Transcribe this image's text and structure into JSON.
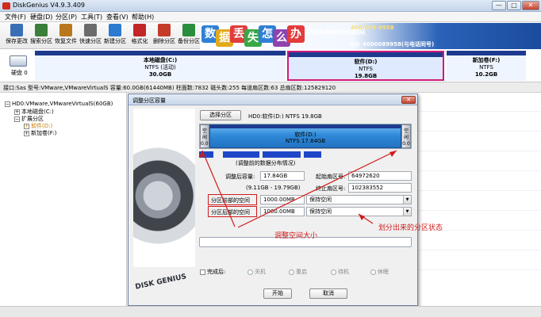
{
  "window": {
    "title": "DiskGenius V4.9.3.409",
    "controls": {
      "minimize": "—",
      "maximize": "□",
      "close": "✕"
    }
  },
  "menu": [
    "文件(F)",
    "硬盘(D)",
    "分区(P)",
    "工具(T)",
    "查看(V)",
    "帮助(H)"
  ],
  "toolbar": [
    {
      "label": "保存更改",
      "icon": "save-icon",
      "color": "#3b6fb5"
    },
    {
      "label": "搜索分区",
      "icon": "search-partition-icon",
      "color": "#3a7f3a"
    },
    {
      "label": "恢复文件",
      "icon": "restore-file-icon",
      "color": "#b9781d"
    },
    {
      "label": "快速分区",
      "icon": "quick-partition-icon",
      "color": "#6c6c6c"
    },
    {
      "label": "新建分区",
      "icon": "new-partition-icon",
      "color": "#2c7bd0"
    },
    {
      "label": "格式化",
      "icon": "format-icon",
      "color": "#c22626"
    },
    {
      "label": "删除分区",
      "icon": "delete-partition-icon",
      "color": "#c43b2a"
    },
    {
      "label": "备份分区",
      "icon": "backup-partition-icon",
      "color": "#2b8e3c"
    }
  ],
  "banner": {
    "chars": [
      "数",
      "据",
      "丢",
      "失",
      "怎",
      "么",
      "办"
    ],
    "char_colors": [
      "#2f7fd6",
      "#e2a91a",
      "#e23c3c",
      "#37a845",
      "#2f7fd6",
      "#8e44ad",
      "#e23c3c"
    ],
    "brand": "DiskGenius团队",
    "phone": "400-008-9958",
    "qq": "QQ: 4000089958(与电话同号)"
  },
  "disk_map": {
    "disk_label": "硬盘 0",
    "partitions": [
      {
        "name": "本地磁盘(C:)",
        "fs": "NTFS (活动)",
        "size": "30.0GB",
        "bg": "#eef5ff",
        "selected": false
      },
      {
        "name": "软件(D:)",
        "fs": "NTFS",
        "size": "19.8GB",
        "bg": "#dfeaff",
        "selected": true
      },
      {
        "name": "新加卷(F:)",
        "fs": "NTFS",
        "size": "10.2GB",
        "bg": "#eef5ff",
        "selected": false
      }
    ]
  },
  "info_line": "接口:Sas  型号:VMware,VMwareVirtualS  容量:60.0GB(61440MB)  柱面数:7832  磁头数:255  每道扇区数:63  总扇区数:125829120",
  "tree": [
    {
      "text": "HD0:VMware,VMwareVirtualS(60GB)",
      "indent": 0,
      "expander": "−",
      "color": "#000"
    },
    {
      "text": "本地磁盘(C:)",
      "indent": 1,
      "expander": "+",
      "color": "#000"
    },
    {
      "text": "扩展分区",
      "indent": 1,
      "expander": "−",
      "color": "#000"
    },
    {
      "text": "软件(D:)",
      "indent": 2,
      "expander": "+",
      "color": "#c97a00"
    },
    {
      "text": "新加卷(F:)",
      "indent": 2,
      "expander": "+",
      "color": "#000"
    }
  ],
  "dialog": {
    "title": "调整分区容量",
    "close": "✕",
    "art_text": "DISK GENIUS",
    "select_partition": "选择分区",
    "partition_info": "HD0:软件(D:) NTFS 19.8GB",
    "left_handle": "空闲",
    "right_handle": "空闲",
    "bar_line1": "软件(D:)",
    "bar_line2": "NTFS 17.84GB",
    "left_handle_size": "0.00",
    "right_handle_size": "0.0",
    "usage_caption": "(调整前的数据分布情况)",
    "size_after_label": "调整后容量:",
    "size_after_value": "17.84GB",
    "range_label": "(9.11GB - 19.79GB)",
    "start_sector_label": "起始扇区号:",
    "start_sector_value": "64972620",
    "end_sector_label": "终止扇区号:",
    "end_sector_value": "102383552",
    "before_space_label": "分区前部的空间",
    "before_space_value": "1000.00MB",
    "before_space_action": "保持空闲",
    "after_space_label": "分区后部的空间",
    "after_space_value": "1000.00MB",
    "after_space_action": "保持空闲",
    "done_label": "完成后:",
    "radios": [
      "关机",
      "重启",
      "待机",
      "休眠"
    ],
    "start_button": "开始",
    "cancel_button": "取消"
  },
  "annotations": {
    "resize": "调整空间大小",
    "state": "划分出来的分区状态"
  },
  "colors": {
    "annotation_red": "#d11a1a",
    "partition_bar": "#1e3a8f",
    "selected_outline": "#d11a7a"
  }
}
